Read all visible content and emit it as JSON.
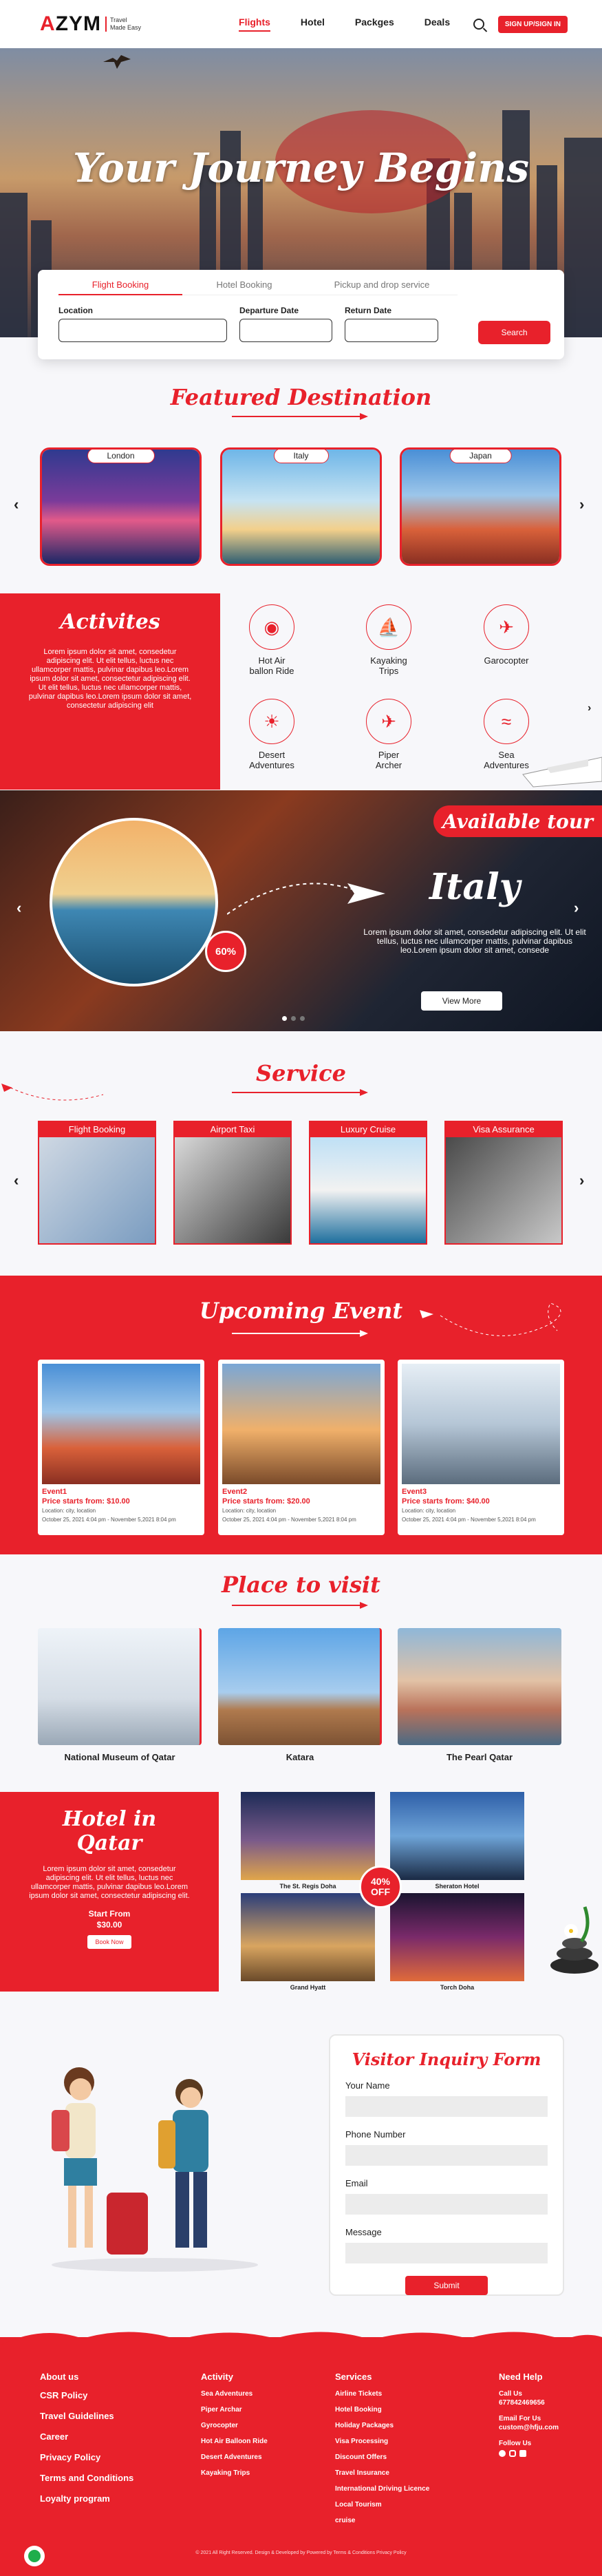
{
  "nav": {
    "logo_mark": "AZYM",
    "logo_tag_1": "Travel",
    "logo_tag_2": "Made Easy",
    "menu": [
      "Flights",
      "Hotel",
      "Packges",
      "Deals"
    ],
    "signin": "SIGN UP/SIGN IN",
    "search_icon": "search-icon"
  },
  "hero": {
    "title": "Your Journey Begins"
  },
  "booking": {
    "tabs": [
      "Flight Booking",
      "Hotel Booking",
      "Pickup and drop service"
    ],
    "location_label": "Location",
    "departure_label": "Departure Date",
    "return_label": "Return Date",
    "search_button": "Search"
  },
  "featured": {
    "title": "Featured Destination",
    "cards": [
      "London",
      "Italy",
      "Japan"
    ]
  },
  "activities": {
    "title": "Activites",
    "text": "Lorem ipsum dolor sit amet, consedetur adipiscing elit. Ut elit tellus, luctus nec ullamcorper mattis, pulvinar dapibus leo.Lorem ipsum dolor sit amet, consectetur adipiscing elit. Ut elit tellus, luctus nec ullamcorper mattis, pulvinar dapibus leo.Lorem ipsum dolor sit amet, consectetur adipiscing elit",
    "items": [
      {
        "line1": "Hot Air",
        "line2": "ballon Ride",
        "icon": "hot-air-balloon-icon"
      },
      {
        "line1": "Kayaking",
        "line2": "Trips",
        "icon": "kayak-icon"
      },
      {
        "line1": "Garocopter",
        "line2": "",
        "icon": "helicopter-icon"
      },
      {
        "line1": "Desert",
        "line2": "Adventures",
        "icon": "desert-icon"
      },
      {
        "line1": "Piper",
        "line2": "Archer",
        "icon": "plane-icon"
      },
      {
        "line1": "Sea",
        "line2": "Adventures",
        "icon": "wave-icon"
      }
    ]
  },
  "tour": {
    "tag": "Available tour",
    "name": "Italy",
    "discount": "60%",
    "text": "Lorem ipsum dolor sit amet, consedetur adipiscing elit. Ut elit tellus, luctus nec ullamcorper mattis, pulvinar dapibus leo.Lorem ipsum dolor sit amet, consede",
    "button": "View More"
  },
  "service": {
    "title": "Service",
    "items": [
      "Flight Booking",
      "Airport Taxi",
      "Luxury Cruise",
      "Visa Assurance"
    ]
  },
  "upcoming": {
    "title": "Upcoming Event",
    "events": [
      {
        "name": "Event1",
        "price": "Price starts from: $10.00",
        "loc": "Location: city, location",
        "date": "October 25, 2021 4:04 pm - November 5,2021 8:04 pm"
      },
      {
        "name": "Event2",
        "price": "Price starts from: $20.00",
        "loc": "Location: city, location",
        "date": "October 25, 2021 4:04 pm - November 5,2021 8:04 pm"
      },
      {
        "name": "Event3",
        "price": "Price starts from: $40.00",
        "loc": "Location: city, location",
        "date": "October 25, 2021 4:04 pm - November 5,2021 8:04 pm"
      }
    ]
  },
  "place": {
    "title": "Place to visit",
    "items": [
      "National Museum of Qatar",
      "Katara",
      "The Pearl Qatar"
    ]
  },
  "hotel": {
    "title": "Hotel in Qatar",
    "text": "Lorem ipsum dolor sit amet, consedetur adipiscing elit. Ut elit tellus, luctus nec ullamcorper mattis, pulvinar dapibus leo.Lorem ipsum dolor sit amet, consectetur adipiscing elit.",
    "start_from": "Start From",
    "price": "$30.00",
    "button": "Book Now",
    "badge_1": "40%",
    "badge_2": "OFF",
    "hotels": [
      "The St. Regis Doha",
      "Sheraton Hotel",
      "Grand Hyatt",
      "Torch Doha"
    ]
  },
  "inquiry": {
    "title": "Visitor Inquiry Form",
    "fields": [
      "Your Name",
      "Phone Number",
      "Email",
      "Message"
    ],
    "submit": "Submit"
  },
  "footer": {
    "col1_title": "About us",
    "col1": [
      "CSR Policy",
      "Travel Guidelines",
      "Career",
      "Privacy Policy",
      "Terms and Conditions",
      "Loyalty program"
    ],
    "col2_title": "Activity",
    "col2": [
      "Sea Adventures",
      "Piper Archar",
      "Gyrocopter",
      "Hot Air Balloon Ride",
      "Desert Adventures",
      "Kayaking Trips"
    ],
    "col3_title": "Services",
    "col3": [
      "Airline Tickets",
      "Hotel Booking",
      "Holiday Packages",
      "Visa Processing",
      "Discount Offers",
      "Travel Insurance",
      "International Driving Licence",
      "Local Tourism",
      "cruise"
    ],
    "col4_title": "Need Help",
    "call_label": "Call Us",
    "phone": "677842469656",
    "email_label": "Email For Us",
    "email": "custom@hfju.com",
    "follow_label": "Follow Us",
    "copyright": "© 2021 All Right Reserved. Design & Developed by  Powered by    Terms & Conditions  Privacy Policy"
  },
  "colors": {
    "accent": "#e8212b"
  }
}
